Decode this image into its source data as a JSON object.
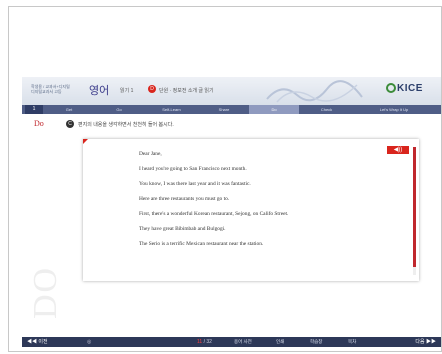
{
  "header": {
    "logo_line1": "학생용 / 교과서+디지털",
    "logo_line2": "디지털교과서 고등",
    "subject": "영어",
    "unit": "읽기 1",
    "step_badge": "D",
    "step_title": "단원 · 정보전 소개 글 읽기",
    "brand": "KICE"
  },
  "tabs": {
    "number": "1",
    "items": [
      {
        "label": "Get"
      },
      {
        "label": "Go"
      },
      {
        "label": "Self-Learn"
      },
      {
        "label": "Share"
      },
      {
        "label": "Do"
      },
      {
        "label": "Check"
      },
      {
        "label": "Let's Wrap It Up"
      }
    ]
  },
  "section": {
    "title": "Do",
    "side_text": "DO",
    "instruction_badge": "C",
    "instruction": "편지의 내용을 생각하면서 천천히 들어 봅시다."
  },
  "letter": {
    "audio_icon": "◀))",
    "lines": [
      "Dear Jane,",
      "I heard you're going to San Francisco next month.",
      "You know, I was there last year and it was fantastic.",
      "Here are three restaurants you must go to.",
      "First, there's a wonderful Korean restaurant, Sejong, on Califo Street.",
      "They have great Bibimbab and Bulgogi.",
      "The Serio is a terrific Mexican restaurant near the station."
    ]
  },
  "footer": {
    "prev_label": "◀◀ 이전",
    "audio_label": "◎",
    "page_current": "11",
    "page_total": "/ 32",
    "menu": [
      "용어 사전",
      "인쇄",
      "학습창",
      "목차"
    ],
    "next_label": "다음 ▶▶"
  },
  "colors": {
    "accent": "#d9251d",
    "nav": "#4f5d86",
    "footer": "#2d3858"
  }
}
